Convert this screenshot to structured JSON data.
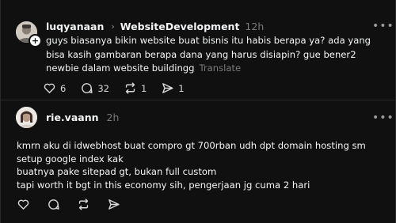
{
  "post": {
    "username": "luqyanaan",
    "topic": "WebsiteDevelopment",
    "time": "12h",
    "body": "guys biasanya bikin website buat bisnis itu habis berapa ya? ada yang bisa kasih gambaran berapa dana yang harus disiapin? gue bener2 newbie dalam website buildingg",
    "translate_label": "Translate",
    "likes": "6",
    "comments": "32",
    "reposts": "1",
    "shares": "1"
  },
  "reply": {
    "username": "rie.vaann",
    "time": "2h",
    "lines": [
      "kmrn aku di idwebhost buat compro gt 700rban udh dpt domain hosting sm setup google index kak",
      "buatnya pake sitepad gt, bukan full custom",
      "tapi worth it bgt in this economy sih, pengerjaan jg cuma 2 hari"
    ]
  },
  "icons": {
    "follow": "plus-icon",
    "like": "heart-icon",
    "comment": "speech-bubble-icon",
    "repost": "repost-icon",
    "share": "send-icon",
    "more": "more-dots-icon"
  },
  "colors": {
    "background": "#101010",
    "text": "#f3f5f7",
    "muted": "#7a7a7a",
    "divider": "#2b2b2b"
  }
}
